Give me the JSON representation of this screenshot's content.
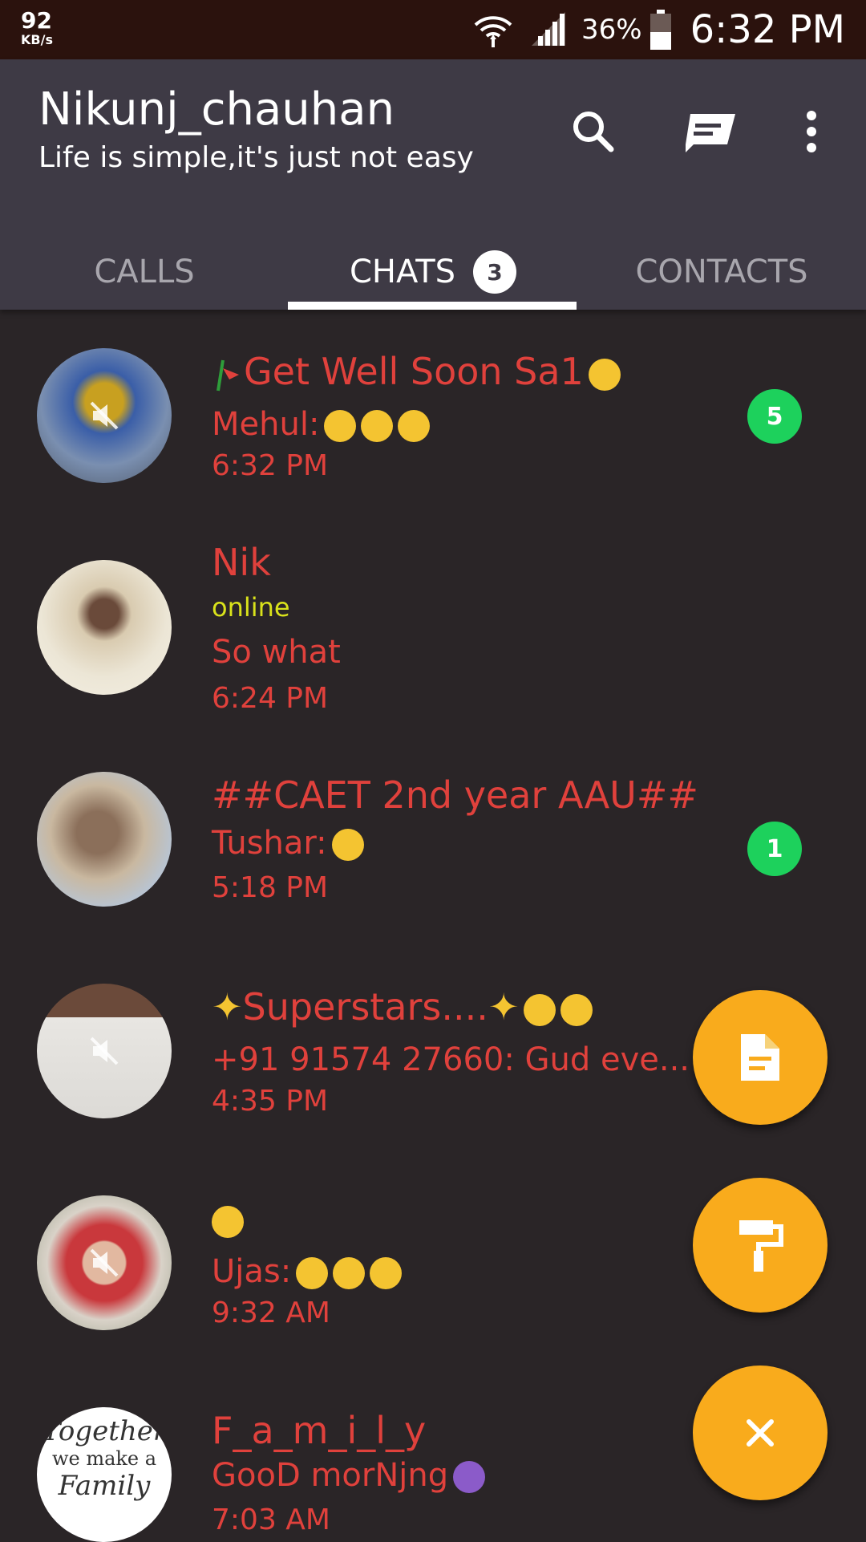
{
  "status_bar": {
    "speed_value": "92",
    "speed_unit": "KB/s",
    "battery_percent": "36%",
    "time": "6:32 PM"
  },
  "header": {
    "title": "Nikunj_chauhan",
    "subtitle": "Life is simple,it's just not easy",
    "icons": [
      "search-icon",
      "compose-icon",
      "more-icon"
    ]
  },
  "tabs": [
    {
      "label": "CALLS",
      "active": false
    },
    {
      "label": "CHATS",
      "active": true,
      "badge": "3"
    },
    {
      "label": "CONTACTS",
      "active": false
    }
  ],
  "chats": [
    {
      "name": "Get Well Soon Sa1",
      "preview": "Mehul:",
      "time": "6:32 PM",
      "unread": "5",
      "muted": true
    },
    {
      "name": "Nik",
      "status": "online",
      "preview": "So what",
      "time": "6:24 PM",
      "muted": false
    },
    {
      "name": "##CAET 2nd year AAU##",
      "preview": "Tushar:",
      "time": "5:18 PM",
      "unread": "1",
      "muted": false
    },
    {
      "name": "Superstars....",
      "preview": "+91 91574 27660: Gud eve...",
      "time": "4:35 PM",
      "muted": true
    },
    {
      "name": "",
      "preview": "Ujas:",
      "time": "9:32 AM",
      "muted": true
    },
    {
      "name": "F_a_m_i_l_y",
      "preview": "GooD morNjng",
      "time": "7:03 AM",
      "muted": false
    }
  ],
  "family_avatar_text": [
    "Together",
    "we make a",
    "Family"
  ],
  "fabs": [
    "new-document-icon",
    "paint-roller-icon",
    "close-icon"
  ],
  "colors": {
    "status_bar": "#2b120d",
    "header": "#3e3a45",
    "background": "#2a2527",
    "chat_text": "#e0413c",
    "online": "#d9e21b",
    "unread_badge": "#1dd15c",
    "fab": "#f9ab1c"
  }
}
